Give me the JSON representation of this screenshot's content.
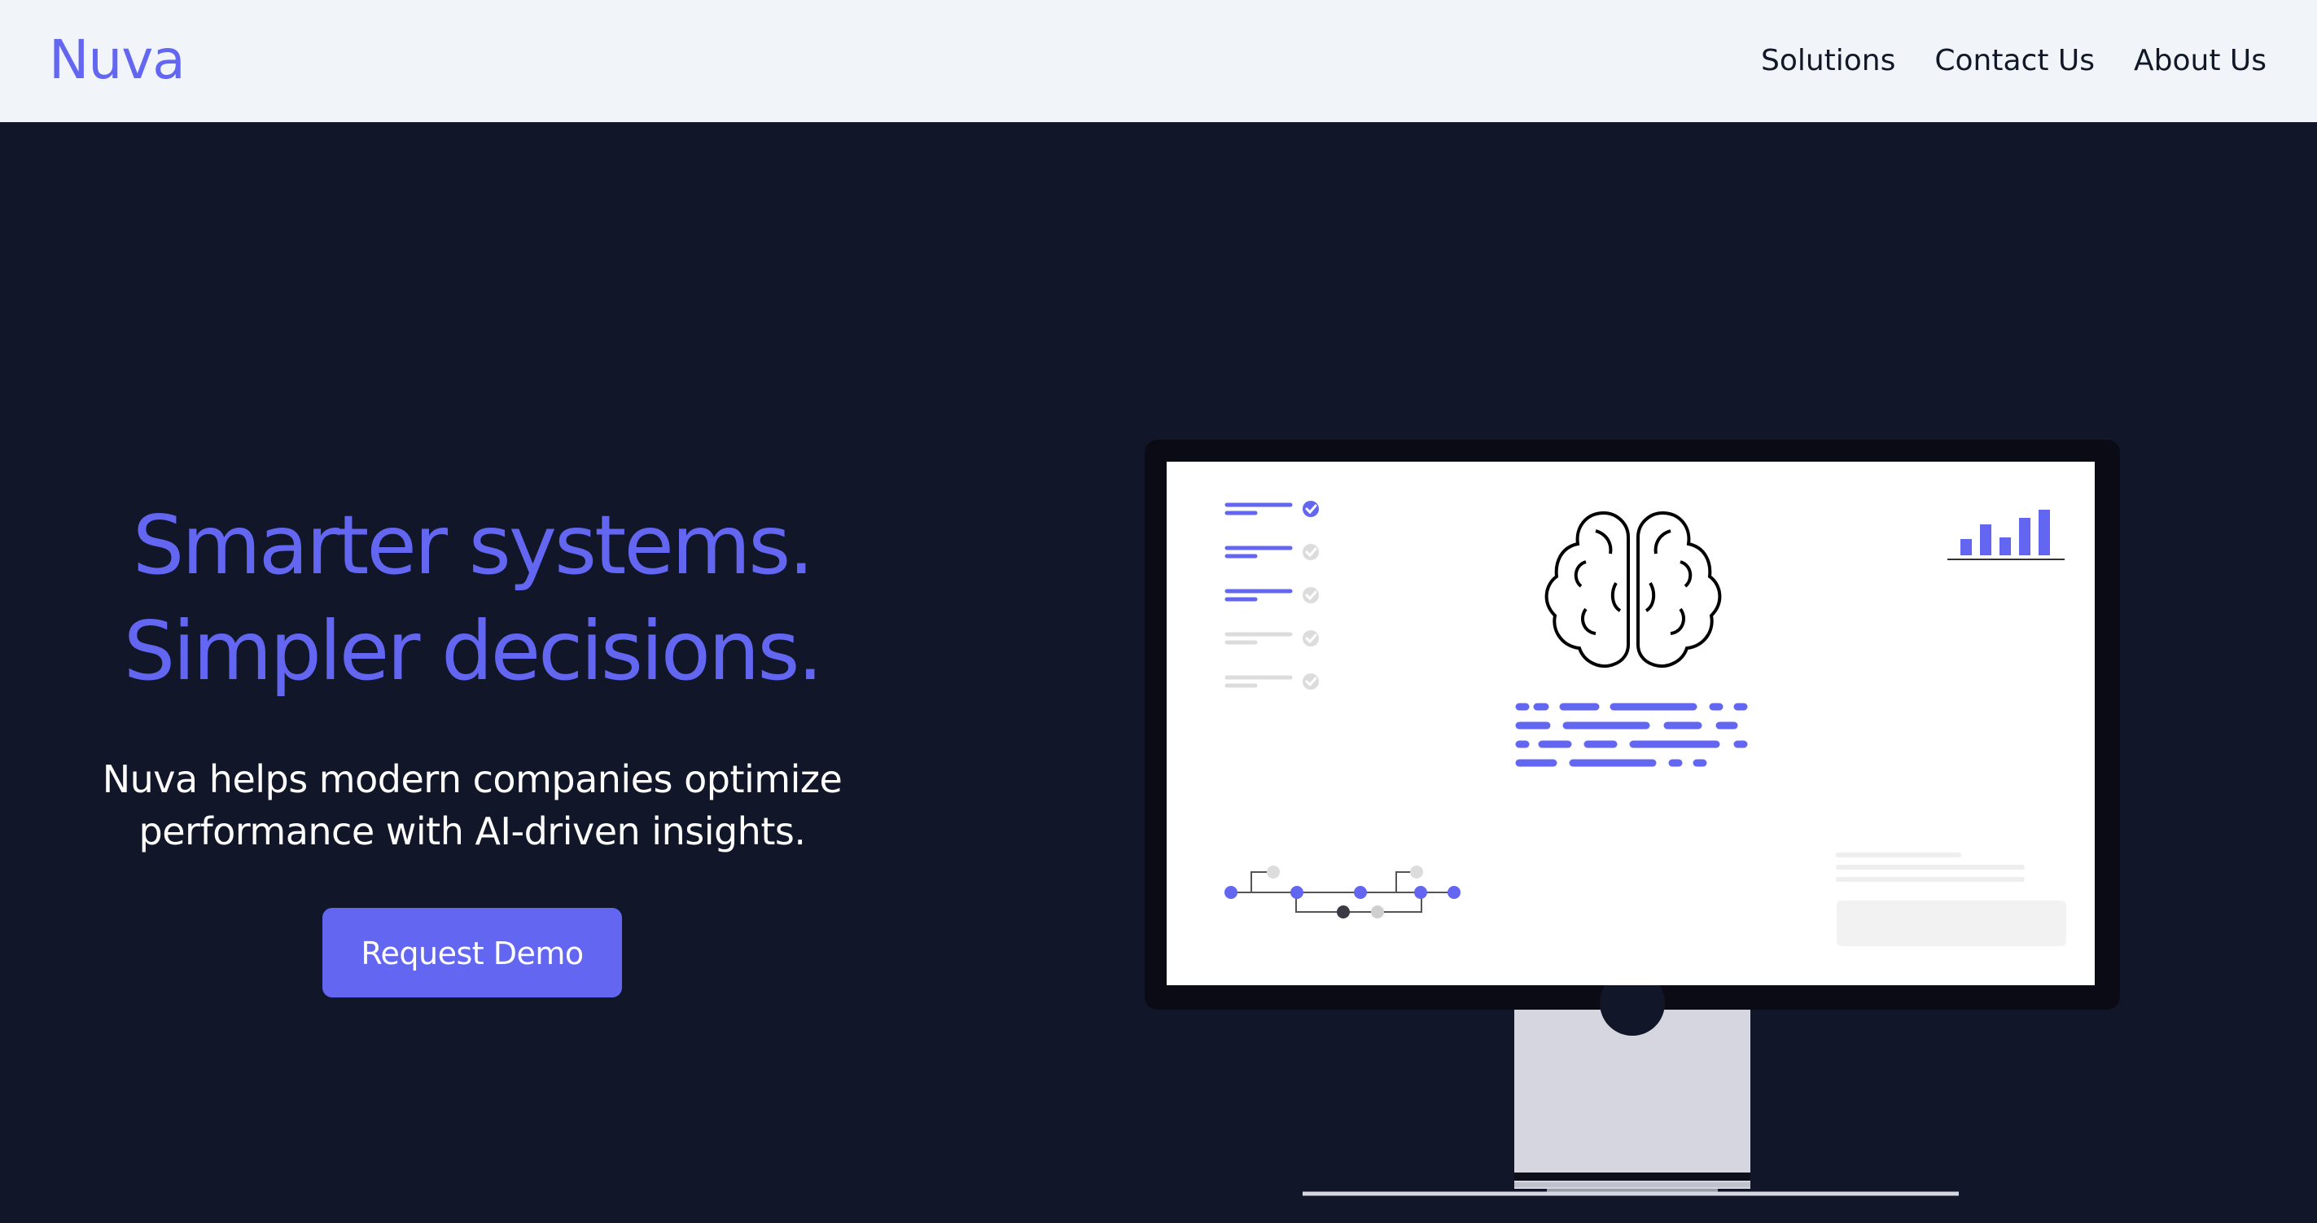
{
  "header": {
    "logo": "Nuva",
    "nav": [
      "Solutions",
      "Contact Us",
      "About Us"
    ]
  },
  "hero": {
    "headline_line1": "Smarter systems.",
    "headline_line2": "Simpler decisions.",
    "subtext": "Nuva helps modern companies optimize performance with AI-driven insights.",
    "cta_label": "Request Demo"
  },
  "colors": {
    "accent": "#6366f1",
    "hero_bg": "#111629",
    "header_bg": "#f1f4f9"
  },
  "illustration": {
    "icons": [
      "computer-monitor",
      "brain-icon",
      "bar-chart-icon",
      "checklist-icon",
      "flow-diagram-icon"
    ]
  }
}
